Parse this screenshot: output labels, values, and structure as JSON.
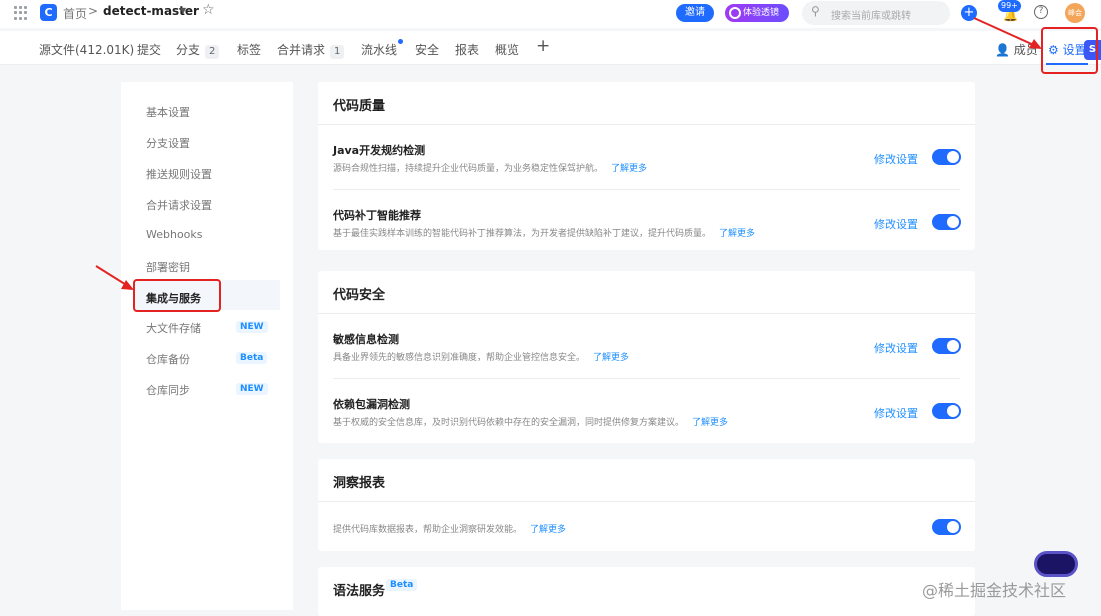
{
  "header": {
    "home": "首页",
    "separator": ">",
    "repo": "detect-master",
    "invite": "邀请",
    "trial": "体验透镜",
    "search_placeholder": "搜索当前库或跳转",
    "notifications": "99+",
    "help": "?",
    "avatar": "峰会"
  },
  "tabs": [
    {
      "label": "源文件(412.01K)"
    },
    {
      "label": "提交"
    },
    {
      "label": "分支",
      "count": "2"
    },
    {
      "label": "标签"
    },
    {
      "label": "合并请求",
      "count": "1"
    },
    {
      "label": "流水线"
    },
    {
      "label": "安全"
    },
    {
      "label": "报表"
    },
    {
      "label": "概览"
    }
  ],
  "tabs_right": {
    "members": "成员",
    "settings": "设置"
  },
  "sidebar": {
    "items": [
      {
        "label": "基本设置"
      },
      {
        "label": "分支设置"
      },
      {
        "label": "推送规则设置"
      },
      {
        "label": "合并请求设置"
      },
      {
        "label": "Webhooks"
      },
      {
        "label": "部署密钥"
      },
      {
        "label": "集成与服务"
      },
      {
        "label": "大文件存储",
        "badge": "NEW"
      },
      {
        "label": "仓库备份",
        "badge": "Beta"
      },
      {
        "label": "仓库同步",
        "badge": "NEW"
      }
    ]
  },
  "sections": {
    "quality": {
      "title": "代码质量",
      "rows": [
        {
          "title": "Java开发规约检测",
          "desc": "源码合规性扫描，持续提升企业代码质量，为业务稳定性保驾护航。",
          "more": "了解更多",
          "edit": "修改设置"
        },
        {
          "title": "代码补丁智能推荐",
          "desc": "基于最佳实践样本训练的智能代码补丁推荐算法，为开发者提供缺陷补丁建议，提升代码质量。",
          "more": "了解更多",
          "edit": "修改设置"
        }
      ]
    },
    "security": {
      "title": "代码安全",
      "rows": [
        {
          "title": "敏感信息检测",
          "desc": "具备业界领先的敏感信息识别准确度，帮助企业管控信息安全。",
          "more": "了解更多",
          "edit": "修改设置"
        },
        {
          "title": "依赖包漏洞检测",
          "desc": "基于权威的安全信息库，及时识别代码依赖中存在的安全漏洞，同时提供修复方案建议。",
          "more": "了解更多",
          "edit": "修改设置"
        }
      ]
    },
    "insight": {
      "title": "洞察报表",
      "desc": "提供代码库数据报表，帮助企业洞察研发效能。",
      "more": "了解更多"
    },
    "syntax": {
      "title": "语法服务",
      "badge": "Beta"
    }
  },
  "watermark": "@稀土掘金技术社区",
  "colors": {
    "accent": "#1f6bff",
    "link": "#1f8fff",
    "annotation": "#e52222"
  }
}
